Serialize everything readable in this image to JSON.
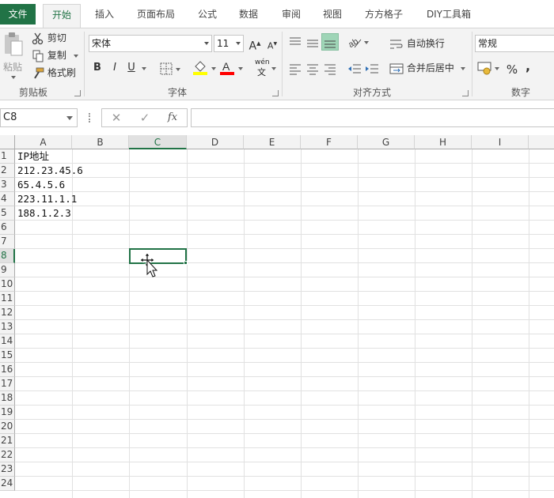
{
  "tabs": [
    "文件",
    "开始",
    "插入",
    "页面布局",
    "公式",
    "数据",
    "审阅",
    "视图",
    "方方格子",
    "DIY工具箱"
  ],
  "clipboard": {
    "paste": "粘贴",
    "cut": "剪切",
    "copy": "复制",
    "format_painter": "格式刷",
    "group": "剪贴板"
  },
  "font": {
    "name": "宋体",
    "size": "11",
    "bold": "B",
    "italic": "I",
    "underline": "U",
    "phonetic_top": "wén",
    "phonetic_bottom": "文",
    "group": "字体"
  },
  "alignment": {
    "wrap_text": "自动换行",
    "merge_center": "合并后居中",
    "group": "对齐方式"
  },
  "number": {
    "format": "常规",
    "percent": "%",
    "comma": ",",
    "group": "数字"
  },
  "formula_bar": {
    "name_box": "C8",
    "fx": "fx",
    "formula": ""
  },
  "grid": {
    "columns": [
      "A",
      "B",
      "C",
      "D",
      "E",
      "F",
      "G",
      "H",
      "I"
    ],
    "rows": [
      "1",
      "2",
      "3",
      "4",
      "5",
      "6",
      "7",
      "8",
      "9",
      "10",
      "11",
      "12",
      "13",
      "14",
      "15",
      "16",
      "17",
      "18",
      "19",
      "20",
      "21",
      "22",
      "23",
      "24"
    ],
    "selected_column": "C",
    "selected_row": "8",
    "cells": {
      "A1": "IP地址",
      "A2": "212.23.45.6",
      "A3": "65.4.5.6",
      "A4": "223.11.1.1",
      "A5": "188.1.2.3"
    }
  },
  "colors": {
    "accent": "#217346",
    "fill_color": "#ffff00",
    "font_color": "#ff0000"
  }
}
